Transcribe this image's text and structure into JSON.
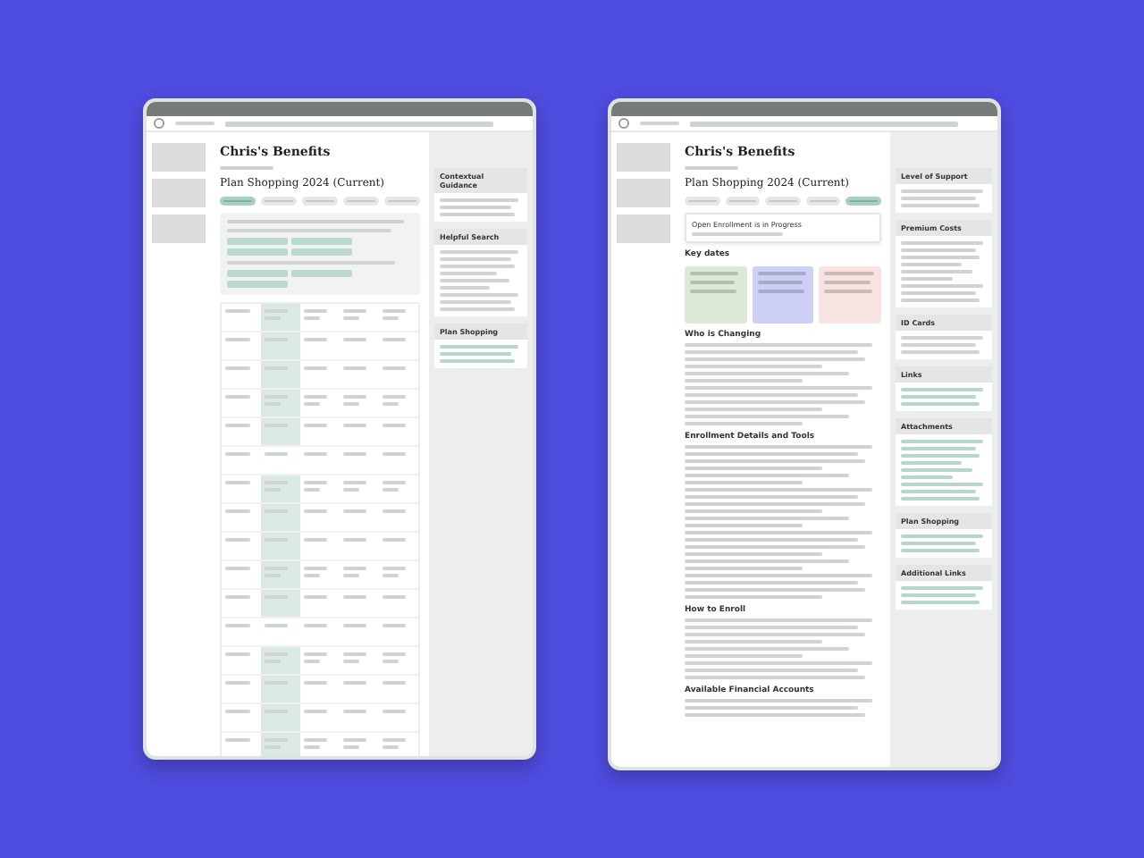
{
  "windows": [
    {
      "kind": "comparison",
      "title": "Chris's Benefits",
      "heading": "Plan Shopping 2024 (Current)",
      "chips": [
        {
          "selected": true
        },
        {
          "selected": false
        },
        {
          "selected": false
        },
        {
          "selected": false
        },
        {
          "selected": false
        }
      ],
      "side": [
        {
          "title": "Contextual Guidance"
        },
        {
          "title": "Helpful Search"
        },
        {
          "title": "Plan Shopping"
        }
      ]
    },
    {
      "kind": "overview",
      "title": "Chris's Benefits",
      "heading": "Plan Shopping 2024 (Current)",
      "chips": [
        {
          "selected": false
        },
        {
          "selected": false
        },
        {
          "selected": false
        },
        {
          "selected": false
        },
        {
          "selected": true
        }
      ],
      "banner": {
        "title": "Open Enrollment is in Progress"
      },
      "key_dates": {
        "title": "Key dates",
        "cards": [
          {
            "color": "#dde8d8"
          },
          {
            "color": "#cdd0f4"
          },
          {
            "color": "#f8e3e3"
          }
        ]
      },
      "sections": [
        {
          "title": "Who is Changing"
        },
        {
          "title": "Enrollment Details and Tools"
        },
        {
          "title": "How to Enroll"
        },
        {
          "title": "Available Financial Accounts"
        }
      ],
      "side": [
        {
          "title": "Level of Support"
        },
        {
          "title": "Premium Costs"
        },
        {
          "title": "ID Cards"
        },
        {
          "title": "Links"
        },
        {
          "title": "Attachments"
        },
        {
          "title": "Plan Shopping"
        },
        {
          "title": "Additional Links"
        }
      ]
    }
  ]
}
